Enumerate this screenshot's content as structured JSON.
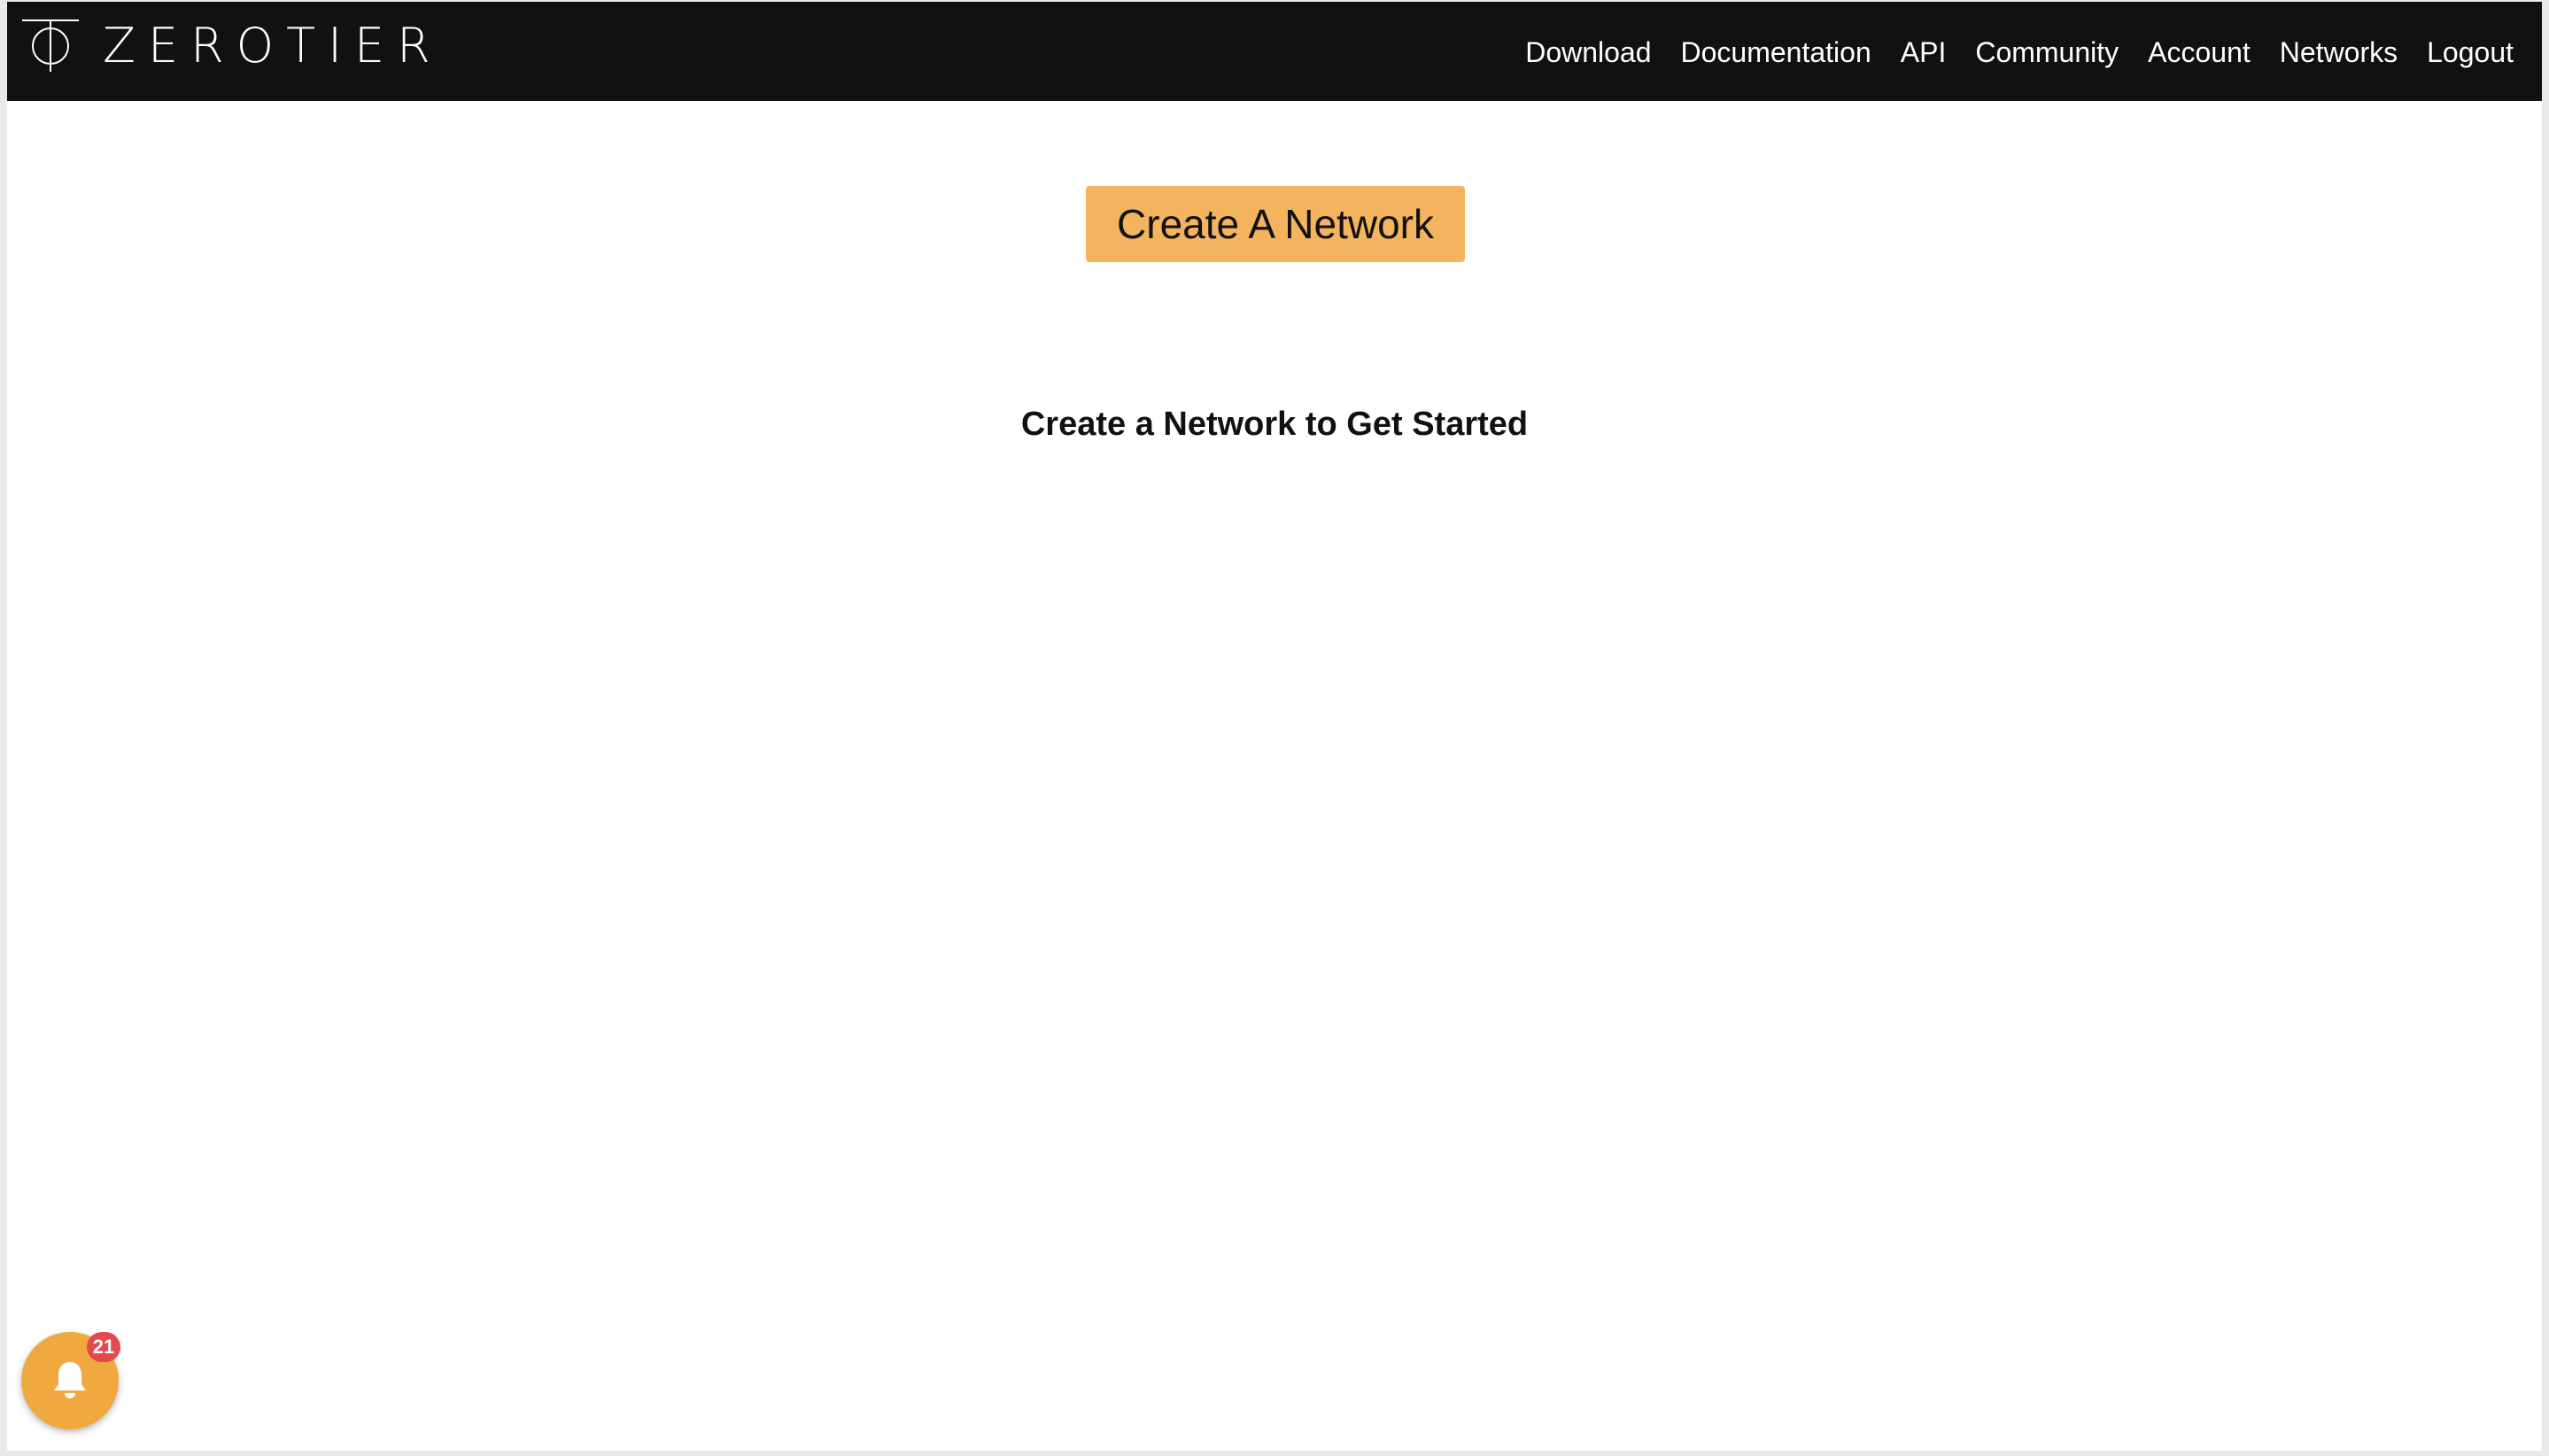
{
  "brand": {
    "name": "ZEROTIER",
    "logo_icon": "zerotier-phi-icon"
  },
  "nav": {
    "items": [
      {
        "label": "Download"
      },
      {
        "label": "Documentation"
      },
      {
        "label": "API"
      },
      {
        "label": "Community"
      },
      {
        "label": "Account"
      },
      {
        "label": "Networks"
      },
      {
        "label": "Logout"
      }
    ]
  },
  "main": {
    "create_button_label": "Create A Network",
    "empty_state_heading": "Create a Network to Get Started"
  },
  "notifications": {
    "icon": "bell-icon",
    "count": "21"
  },
  "colors": {
    "topbar": "#111111",
    "accent": "#f4b45f",
    "bell_button": "#efa93e",
    "badge": "#e5484d"
  }
}
